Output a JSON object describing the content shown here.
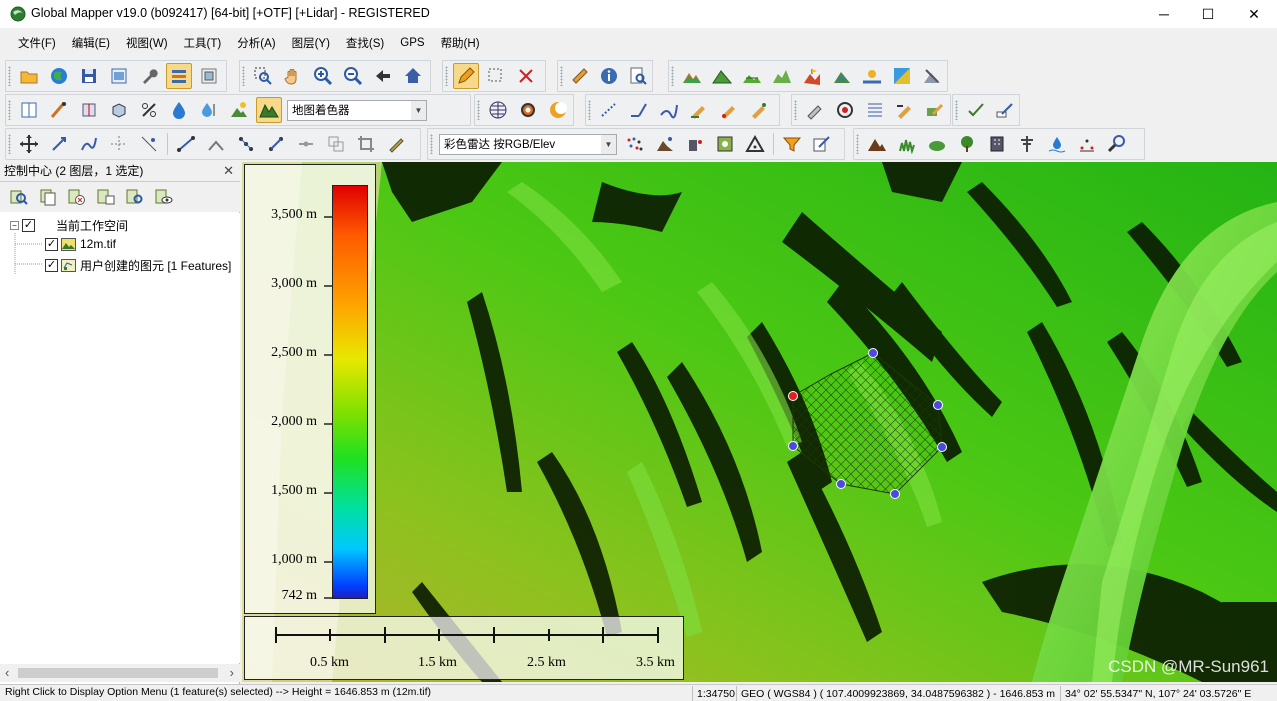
{
  "window": {
    "title": "Global Mapper v19.0 (b092417) [64-bit] [+OTF] [+Lidar] - REGISTERED",
    "minimize": "─",
    "maximize": "☐",
    "close": "✕"
  },
  "menu": [
    "文件(F)",
    "编辑(E)",
    "视图(W)",
    "工具(T)",
    "分析(A)",
    "图层(Y)",
    "查找(S)",
    "GPS",
    "帮助(H)"
  ],
  "toolbars": {
    "shader_dropdown": "地图着色器",
    "render_dropdown": "彩色雷达 按RGB/Elev"
  },
  "control_center": {
    "title": "控制中心 (2 图层，1 选定)",
    "close": "✕",
    "tree": {
      "workspace": "当前工作空间",
      "layer1": "12m.tif",
      "layer2": "用户创建的图元 [1 Features]"
    },
    "scroll_left": "‹",
    "scroll_right": "›"
  },
  "map": {
    "legend_labels": [
      "3,500 m",
      "3,000 m",
      "2,500 m",
      "2,000 m",
      "1,500 m",
      "1,000 m",
      "742 m"
    ],
    "scale_labels": [
      "0.5 km",
      "1.5 km",
      "2.5 km",
      "3.5 km"
    ],
    "watermark": "CSDN @MR-Sun961",
    "colors": {
      "polygon_vertex": "#4a4ae0",
      "polygon_start_vertex": "#e02020",
      "hatch": "#1a3a00"
    }
  },
  "status": {
    "message": "Right Click to Display Option Menu (1 feature(s) selected) --> Height = 1646.853 m (12m.tif)",
    "scale": "1:34750",
    "coords": "GEO ( WGS84 ) ( 107.4009923869, 34.0487596382 ) - 1646.853 m",
    "dms": "34° 02' 55.5347\" N, 107° 24' 03.5726\" E"
  }
}
